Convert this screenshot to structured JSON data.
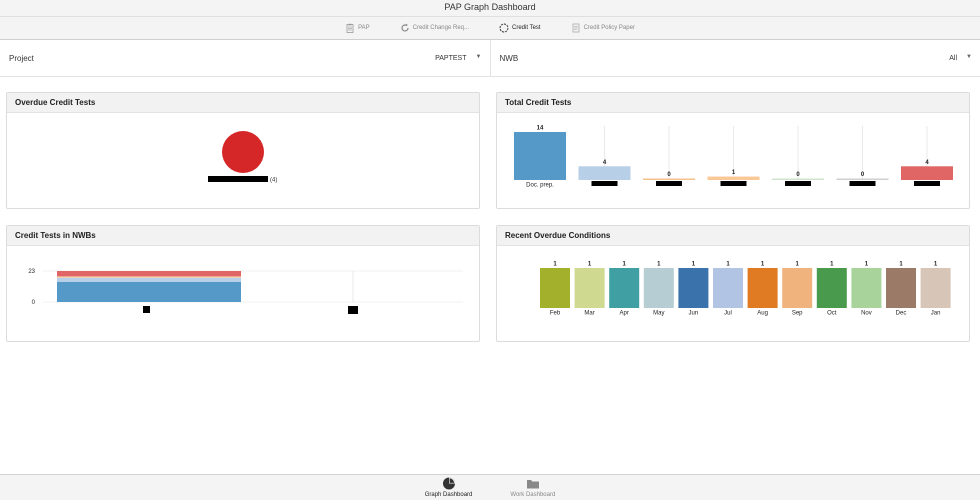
{
  "app": {
    "title": "PAP Graph Dashboard"
  },
  "tabs": [
    {
      "label": "PAP",
      "icon": "clipboard-icon",
      "active": false
    },
    {
      "label": "Credit Change Req...",
      "icon": "refresh-icon",
      "active": false
    },
    {
      "label": "Credit Test",
      "icon": "circle-dashed-icon",
      "active": true
    },
    {
      "label": "Credit Policy Paper",
      "icon": "document-icon",
      "active": false
    }
  ],
  "filters": {
    "project": {
      "label": "Project",
      "value": "PAPTEST"
    },
    "nwb": {
      "label": "NWB",
      "value": "All"
    }
  },
  "panels": {
    "overdue_credit_tests": {
      "title": "Overdue Credit Tests"
    },
    "total_credit_tests": {
      "title": "Total Credit Tests"
    },
    "credit_tests_in_nwbs": {
      "title": "Credit Tests in NWBs"
    },
    "recent_overdue_conditions": {
      "title": "Recent Overdue Conditions"
    }
  },
  "bottom_nav": [
    {
      "label": "Graph Dashboard",
      "icon": "pie-chart-icon",
      "active": true
    },
    {
      "label": "Work Dashboard",
      "icon": "folder-icon",
      "active": false
    }
  ],
  "colors": {
    "red": "#d62728",
    "blue": "#5599c9",
    "accent_red": "#e06666"
  },
  "chart_data": [
    {
      "type": "pie",
      "slices": [
        {
          "label": "",
          "value": 4,
          "value_label": "(4)",
          "color": "#d62728"
        }
      ]
    },
    {
      "type": "bar",
      "categories": [
        "Doc. prep.",
        "",
        "",
        "",
        "",
        "",
        ""
      ],
      "values": [
        14,
        4,
        0,
        1,
        0,
        0,
        4
      ],
      "colors": [
        "#5599c9",
        "#b8cfe8",
        "#f6c08a",
        "#f9c896",
        "#cfe3d0",
        "#cfcfcf",
        "#e06666"
      ],
      "ylim": [
        0,
        14
      ]
    },
    {
      "type": "bar",
      "orientation": "stacked",
      "categories": [
        "",
        ""
      ],
      "yticks": [
        0,
        23
      ],
      "series": [
        {
          "values": [
            15,
            0
          ],
          "color": "#5599c9"
        },
        {
          "values": [
            3,
            0
          ],
          "color": "#b8cfe8"
        },
        {
          "values": [
            1,
            0
          ],
          "color": "#f6c9a1"
        },
        {
          "values": [
            4,
            0
          ],
          "color": "#e06666"
        }
      ],
      "ylim": [
        0,
        23
      ]
    },
    {
      "type": "bar",
      "categories": [
        "Feb",
        "Mar",
        "Apr",
        "May",
        "Jun",
        "Jul",
        "Aug",
        "Sep",
        "Oct",
        "Nov",
        "Dec",
        "Jan"
      ],
      "values": [
        1,
        1,
        1,
        1,
        1,
        1,
        1,
        1,
        1,
        1,
        1,
        1
      ],
      "colors": [
        "#a2b02c",
        "#cfd98f",
        "#3f9fa3",
        "#b5cdd3",
        "#3a73ab",
        "#b2c4e3",
        "#e07b23",
        "#f0b37e",
        "#4a9a4e",
        "#a8d49c",
        "#9b7b68",
        "#d7c6b8"
      ],
      "ylim": [
        0,
        1
      ]
    }
  ]
}
